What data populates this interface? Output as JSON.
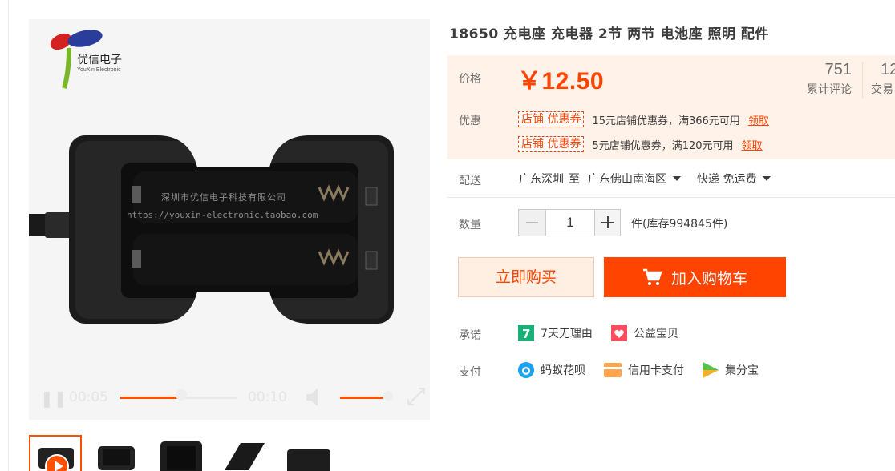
{
  "gallery": {
    "brand_name": "优信电子",
    "brand_sub": "YouXin Electronic",
    "watermark_line1": "深圳市优信电子科技有限公司",
    "watermark_line2": "https://youxin-electronic.taobao.com",
    "video": {
      "current_time": "00:05",
      "total_time": "00:10",
      "progress": 0.5,
      "volume": 0.85
    }
  },
  "product": {
    "title": "18650 充电座 充电器 2节 两节 电池座 照明 配件"
  },
  "price": {
    "label": "价格",
    "value": "￥12.50"
  },
  "stats": {
    "reviews_count": "751",
    "reviews_label": "累计评论",
    "trades_count": "12",
    "trades_label": "交易"
  },
  "promo": {
    "label": "优惠",
    "coupons": [
      {
        "tag": "店铺 优惠券",
        "desc": "15元店铺优惠券，满366元可用",
        "link": "领取"
      },
      {
        "tag": "店铺 优惠券",
        "desc": "5元店铺优惠券，满120元可用",
        "link": "领取"
      }
    ]
  },
  "shipping": {
    "label": "配送",
    "from": "广东深圳",
    "to_word": "至",
    "destination": "广东佛山南海区",
    "method": "快递 免运费"
  },
  "quantity": {
    "label": "数量",
    "value": "1",
    "stock_text": "件(库存994845件)"
  },
  "actions": {
    "buy_now": "立即购买",
    "add_cart": "加入购物车"
  },
  "promise": {
    "label": "承诺",
    "items": [
      "7天无理由",
      "公益宝贝"
    ]
  },
  "payment": {
    "label": "支付",
    "items": [
      "蚂蚁花呗",
      "信用卡支付",
      "集分宝"
    ]
  },
  "colors": {
    "accent": "#ff4400",
    "price_bg": "#fff2e8"
  }
}
